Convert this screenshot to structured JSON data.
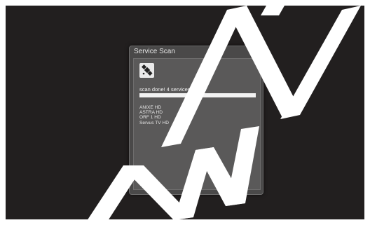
{
  "dialog": {
    "title": "Service Scan",
    "icon": "satellite-icon",
    "status": "scan done! 4 services found!",
    "progress": 1.0,
    "services": [
      "ANIXE HD",
      "ASTRA HD",
      "ORF 1 HD",
      "Servus TV HD"
    ]
  },
  "colors": {
    "screen_background": "#221f1f",
    "dialog_background": "#4a4949",
    "progress_fill": "#f2f2f2"
  }
}
